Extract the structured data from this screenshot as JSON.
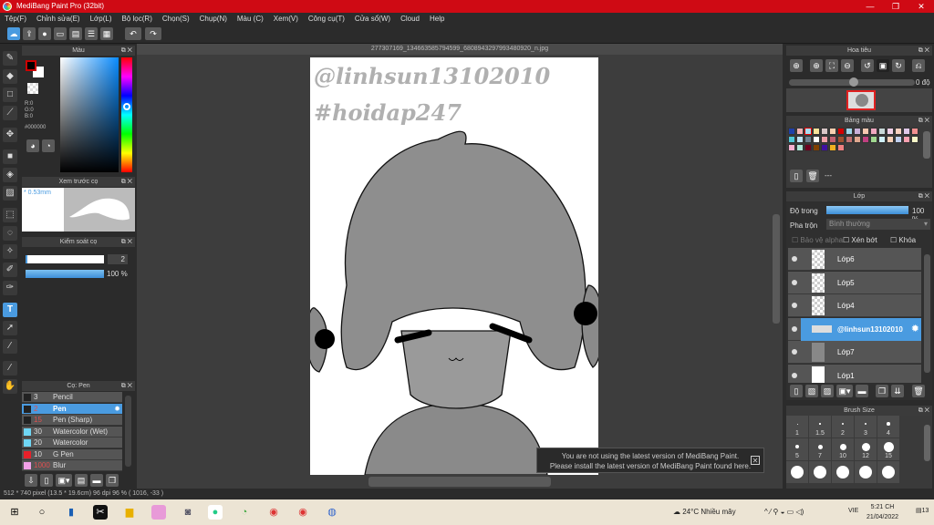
{
  "app": {
    "title": "MediBang Paint Pro (32bit)",
    "accent": "#cf0a14",
    "selection_color": "#4a9be0"
  },
  "menu": [
    "Tệp(F)",
    "Chỉnh sửa(E)",
    "Lớp(L)",
    "Bộ lọc(R)",
    "Chọn(S)",
    "Chụp(N)",
    "Màu (C)",
    "Xem(V)",
    "Công cụ(T)",
    "Cửa sổ(W)",
    "Cloud",
    "Help"
  ],
  "document": {
    "tab": "277307169_1346635857945​99_6808943297993480920_n.jpg",
    "watermark1": "@linhsun13102010",
    "watermark2": "#hoidap247"
  },
  "color_panel": {
    "title": "Màu",
    "r": "R:0",
    "g": "G:0",
    "b": "B:0",
    "hex": "#000000"
  },
  "brush_preview": {
    "title": "Xem trước cọ",
    "size": "* 0.53mm"
  },
  "brush_control": {
    "title": "Kiểm soát cọ",
    "size": "2",
    "opacity": "100 %",
    "opacity_value": 100
  },
  "brush_list": {
    "title": "Cọ: Pen",
    "items": [
      {
        "size": "3",
        "name": "Pencil",
        "color": "#222222"
      },
      {
        "size": "2",
        "name": "Pen",
        "color": "#222222",
        "selected": true
      },
      {
        "size": "15",
        "name": "Pen (Sharp)",
        "color": "#222222"
      },
      {
        "size": "30",
        "name": "Watercolor (Wet)",
        "color": "#6fd6f5"
      },
      {
        "size": "20",
        "name": "Watercolor",
        "color": "#6fd6f5"
      },
      {
        "size": "10",
        "name": "G Pen",
        "color": "#e8202a"
      },
      {
        "size": "1000",
        "name": "Blur",
        "color": "#f2a0e8"
      }
    ]
  },
  "navigator": {
    "title": "Hoa tiêu",
    "angle": "0 độ"
  },
  "palette": {
    "title": "Bảng màu",
    "more": "---",
    "colors": [
      "#1f3fa8",
      "#f4b4b4",
      "#a8dcef",
      "#f8e39a",
      "#d9c7c7",
      "#f6cfb0",
      "#d40000",
      "#9fd6e8",
      "#c8b0d8",
      "#f6c8b0",
      "#f0a8c0",
      "#c8d8d8",
      "#f0d0e8",
      "#f8d0c0",
      "#e0c8e8",
      "#f09090",
      "#50c8d8",
      "#c0e0f0",
      "#708090",
      "#ffffff",
      "#f0a0a8",
      "#c06070",
      "#a05030",
      "#c07070",
      "#e0a890",
      "#c04080",
      "#a0d890",
      "#d0f0f8",
      "#f8d0b8",
      "#c0d0f0",
      "#f8a0b0",
      "#f8f8c8",
      "#f8b0d0",
      "#b0e8d8",
      "#700020",
      "#804000",
      "#4010a0",
      "#f0b020",
      "#f08080"
    ]
  },
  "layers": {
    "title": "Lớp",
    "opacity_label": "Độ trong",
    "opacity": "100 %",
    "blend_label": "Pha trộn",
    "blend": "Bình thường",
    "protect_alpha": "Bảo vệ alpha",
    "clipping": "Xén bớt",
    "lock": "Khóa",
    "items": [
      "Lớp6",
      "Lớp5",
      "Lớp4",
      "@linhsun13102010",
      "Lớp7",
      "Lớp1"
    ]
  },
  "brush_size": {
    "title": "Brush Size",
    "sizes": [
      "1",
      "1.5",
      "2",
      "3",
      "4",
      "5",
      "7",
      "10",
      "12",
      "15"
    ]
  },
  "notice": {
    "line1": "You are not using the latest version of MediBang Paint.",
    "line2": "Please install the latest version of MediBang Paint found here."
  },
  "status": "512 * 740 pixel  (13.5 * 19.6cm)  96 dpi  96 %  ( 1016, -33 )",
  "taskbar": {
    "weather": "24°C  Nhiều mây",
    "lang": "VIE",
    "time": "5:21 CH",
    "date": "21/04/2022",
    "notif": "13"
  }
}
